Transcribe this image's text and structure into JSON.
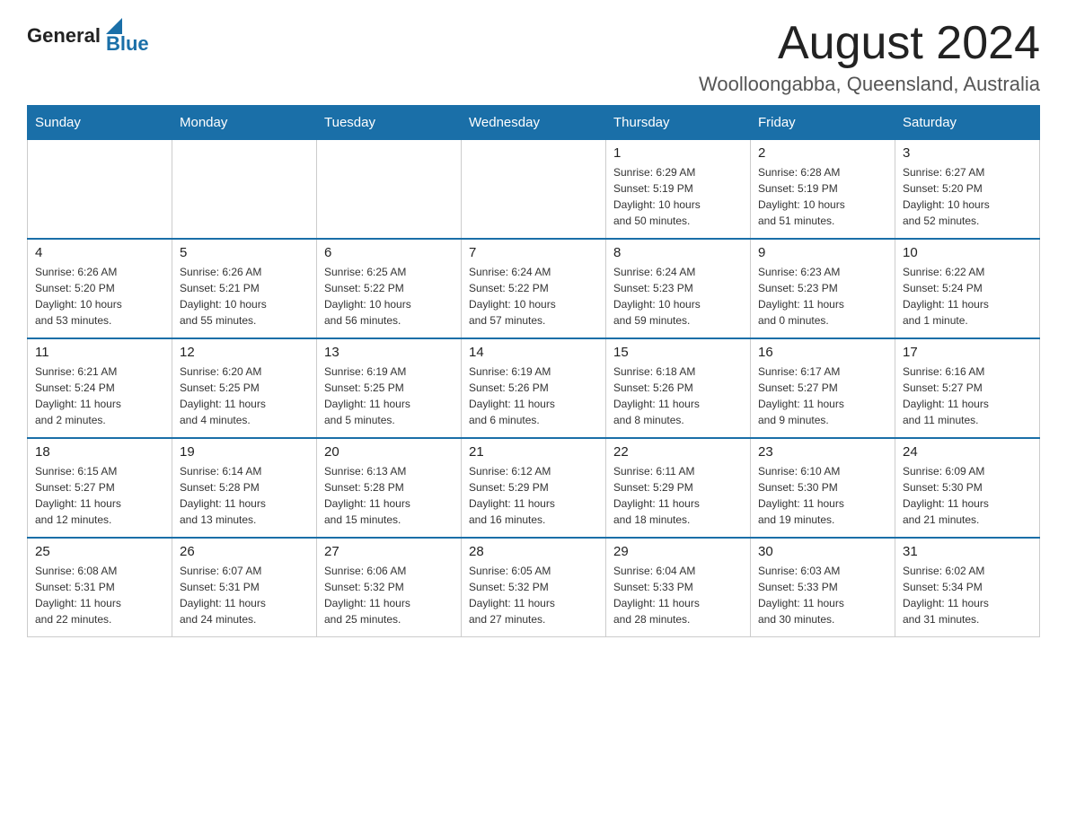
{
  "logo": {
    "general": "General",
    "blue": "Blue"
  },
  "header": {
    "month": "August 2024",
    "location": "Woolloongabba, Queensland, Australia"
  },
  "weekdays": [
    "Sunday",
    "Monday",
    "Tuesday",
    "Wednesday",
    "Thursday",
    "Friday",
    "Saturday"
  ],
  "weeks": [
    [
      {
        "day": "",
        "info": ""
      },
      {
        "day": "",
        "info": ""
      },
      {
        "day": "",
        "info": ""
      },
      {
        "day": "",
        "info": ""
      },
      {
        "day": "1",
        "info": "Sunrise: 6:29 AM\nSunset: 5:19 PM\nDaylight: 10 hours\nand 50 minutes."
      },
      {
        "day": "2",
        "info": "Sunrise: 6:28 AM\nSunset: 5:19 PM\nDaylight: 10 hours\nand 51 minutes."
      },
      {
        "day": "3",
        "info": "Sunrise: 6:27 AM\nSunset: 5:20 PM\nDaylight: 10 hours\nand 52 minutes."
      }
    ],
    [
      {
        "day": "4",
        "info": "Sunrise: 6:26 AM\nSunset: 5:20 PM\nDaylight: 10 hours\nand 53 minutes."
      },
      {
        "day": "5",
        "info": "Sunrise: 6:26 AM\nSunset: 5:21 PM\nDaylight: 10 hours\nand 55 minutes."
      },
      {
        "day": "6",
        "info": "Sunrise: 6:25 AM\nSunset: 5:22 PM\nDaylight: 10 hours\nand 56 minutes."
      },
      {
        "day": "7",
        "info": "Sunrise: 6:24 AM\nSunset: 5:22 PM\nDaylight: 10 hours\nand 57 minutes."
      },
      {
        "day": "8",
        "info": "Sunrise: 6:24 AM\nSunset: 5:23 PM\nDaylight: 10 hours\nand 59 minutes."
      },
      {
        "day": "9",
        "info": "Sunrise: 6:23 AM\nSunset: 5:23 PM\nDaylight: 11 hours\nand 0 minutes."
      },
      {
        "day": "10",
        "info": "Sunrise: 6:22 AM\nSunset: 5:24 PM\nDaylight: 11 hours\nand 1 minute."
      }
    ],
    [
      {
        "day": "11",
        "info": "Sunrise: 6:21 AM\nSunset: 5:24 PM\nDaylight: 11 hours\nand 2 minutes."
      },
      {
        "day": "12",
        "info": "Sunrise: 6:20 AM\nSunset: 5:25 PM\nDaylight: 11 hours\nand 4 minutes."
      },
      {
        "day": "13",
        "info": "Sunrise: 6:19 AM\nSunset: 5:25 PM\nDaylight: 11 hours\nand 5 minutes."
      },
      {
        "day": "14",
        "info": "Sunrise: 6:19 AM\nSunset: 5:26 PM\nDaylight: 11 hours\nand 6 minutes."
      },
      {
        "day": "15",
        "info": "Sunrise: 6:18 AM\nSunset: 5:26 PM\nDaylight: 11 hours\nand 8 minutes."
      },
      {
        "day": "16",
        "info": "Sunrise: 6:17 AM\nSunset: 5:27 PM\nDaylight: 11 hours\nand 9 minutes."
      },
      {
        "day": "17",
        "info": "Sunrise: 6:16 AM\nSunset: 5:27 PM\nDaylight: 11 hours\nand 11 minutes."
      }
    ],
    [
      {
        "day": "18",
        "info": "Sunrise: 6:15 AM\nSunset: 5:27 PM\nDaylight: 11 hours\nand 12 minutes."
      },
      {
        "day": "19",
        "info": "Sunrise: 6:14 AM\nSunset: 5:28 PM\nDaylight: 11 hours\nand 13 minutes."
      },
      {
        "day": "20",
        "info": "Sunrise: 6:13 AM\nSunset: 5:28 PM\nDaylight: 11 hours\nand 15 minutes."
      },
      {
        "day": "21",
        "info": "Sunrise: 6:12 AM\nSunset: 5:29 PM\nDaylight: 11 hours\nand 16 minutes."
      },
      {
        "day": "22",
        "info": "Sunrise: 6:11 AM\nSunset: 5:29 PM\nDaylight: 11 hours\nand 18 minutes."
      },
      {
        "day": "23",
        "info": "Sunrise: 6:10 AM\nSunset: 5:30 PM\nDaylight: 11 hours\nand 19 minutes."
      },
      {
        "day": "24",
        "info": "Sunrise: 6:09 AM\nSunset: 5:30 PM\nDaylight: 11 hours\nand 21 minutes."
      }
    ],
    [
      {
        "day": "25",
        "info": "Sunrise: 6:08 AM\nSunset: 5:31 PM\nDaylight: 11 hours\nand 22 minutes."
      },
      {
        "day": "26",
        "info": "Sunrise: 6:07 AM\nSunset: 5:31 PM\nDaylight: 11 hours\nand 24 minutes."
      },
      {
        "day": "27",
        "info": "Sunrise: 6:06 AM\nSunset: 5:32 PM\nDaylight: 11 hours\nand 25 minutes."
      },
      {
        "day": "28",
        "info": "Sunrise: 6:05 AM\nSunset: 5:32 PM\nDaylight: 11 hours\nand 27 minutes."
      },
      {
        "day": "29",
        "info": "Sunrise: 6:04 AM\nSunset: 5:33 PM\nDaylight: 11 hours\nand 28 minutes."
      },
      {
        "day": "30",
        "info": "Sunrise: 6:03 AM\nSunset: 5:33 PM\nDaylight: 11 hours\nand 30 minutes."
      },
      {
        "day": "31",
        "info": "Sunrise: 6:02 AM\nSunset: 5:34 PM\nDaylight: 11 hours\nand 31 minutes."
      }
    ]
  ]
}
